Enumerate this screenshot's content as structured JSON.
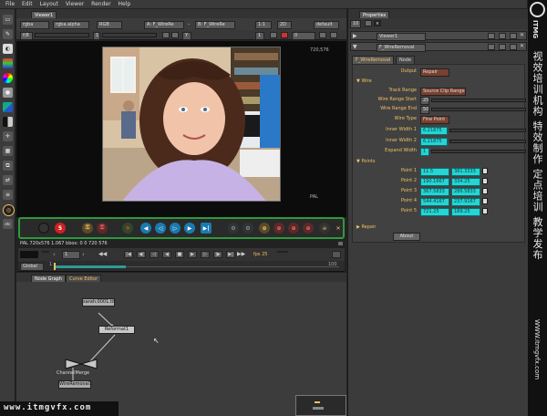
{
  "menu": [
    "File",
    "Edit",
    "Layout",
    "Viewer",
    "Render",
    "Help"
  ],
  "viewer": {
    "tab": "Viewer1",
    "row1": {
      "channels": "rgba",
      "alpha": "rgba.alpha",
      "colorspace": "RGB",
      "input_a": "A: F_WireRe",
      "dash": "-",
      "input_b": "B: F_WireRe",
      "frame_zoom": "1:1",
      "view_mode": "2D",
      "default": "default"
    },
    "row2": {
      "fstop": "f/8",
      "one": "1",
      "y": "Y",
      "one_b": "1",
      "frame_field": "0"
    },
    "format_right": "720,576",
    "format_corner": "PAL",
    "status": "PAL 720x576 1.067 bbox: 0 0 720 576",
    "frame": "1",
    "fps": "fps 25",
    "timebar_mode": "Global",
    "frame_start": "1",
    "frame_end": "100"
  },
  "playback_icons": [
    "record-icon",
    "stop-icon",
    "key-icon",
    "key-add-icon",
    "prev-key-icon",
    "step-back-icon",
    "play-back-icon",
    "play-icon",
    "step-forward-icon",
    "next-key-icon",
    "loop-icon",
    "bookend-icon",
    "ab-icon",
    "ab2-icon",
    "ab3-icon",
    "ab4-icon",
    "ab5-icon",
    "skull-icon",
    "close-icon"
  ],
  "nodegraph": {
    "tabs": [
      "Node Graph",
      "Curve Editor"
    ],
    "nodes": [
      "sarah.0001.tif",
      "Reformat1",
      "ChannelMerge",
      "WireRemoval"
    ],
    "channel_node_label": "ChannelMerge",
    "wire_node_label": "WireRemoval1"
  },
  "properties": {
    "tab": "Properties",
    "count": "10",
    "node1": "Viewer1",
    "node2": "F_WireRemoval",
    "panel_tabs": [
      "F_WireRemoval",
      "Node"
    ],
    "output_label": "Output",
    "output_value": "Repair",
    "wire_group": "Wire",
    "track_range_label": "Track Range",
    "track_range_value": "Source Clip Range",
    "range_start_label": "Wire Range Start",
    "range_start_value": "25",
    "range_end_label": "Wire Range End",
    "range_end_value": "50",
    "wire_type_label": "Wire Type",
    "wire_type_value": "Fine Point",
    "inner1_label": "Inner Width 1",
    "inner1_value": "6.21875",
    "inner2_label": "Inner Width 2",
    "inner2_value": "6.21875",
    "expand_label": "Expand Width",
    "expand_value": "1",
    "points_group": "Points",
    "points": [
      {
        "label": "Point 1",
        "x": "11.5",
        "y": "381.3333"
      },
      {
        "label": "Point 2",
        "x": "190.1667",
        "y": "334.25"
      },
      {
        "label": "Point 3",
        "x": "367.5833",
        "y": "286.5833"
      },
      {
        "label": "Point 4",
        "x": "544.4167",
        "y": "237.9167"
      },
      {
        "label": "Point 5",
        "x": "721.25",
        "y": "189.25"
      }
    ],
    "repair_group": "Repair",
    "about_label": "About"
  },
  "watermark": {
    "brand": "ITMG",
    "cn": "视效培训机构 特效制作 定点培训 教学发布",
    "url_side": "WWW.itmgvfx.com",
    "url_bottom": "www.itmgvfx.com"
  },
  "colors": {
    "accent_cyan": "#27d3d3",
    "playback_green": "#2e9a3a",
    "label_orange": "#f0c060"
  }
}
